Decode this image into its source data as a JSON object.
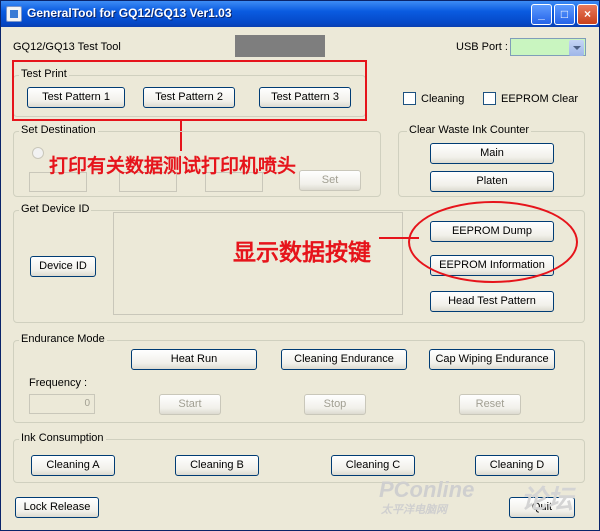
{
  "window": {
    "title": "GeneralTool for GQ12/GQ13 Ver1.03",
    "minimize": "_",
    "maximize": "□",
    "close": "×"
  },
  "header": {
    "tool_label": "GQ12/GQ13 Test Tool",
    "usb_label": "USB Port :",
    "usb_value": ""
  },
  "test_print": {
    "label": "Test Print",
    "buttons": [
      "Test Pattern 1",
      "Test Pattern 2",
      "Test Pattern 3"
    ]
  },
  "options": {
    "cleaning": "Cleaning",
    "eeprom_clear": "EEPROM Clear"
  },
  "set_destination": {
    "label": "Set Destination",
    "set_button": "Set"
  },
  "waste_ink": {
    "label": "Clear Waste Ink Counter",
    "main": "Main",
    "platen": "Platen"
  },
  "device_id": {
    "label": "Get Device ID",
    "button": "Device ID",
    "eeprom_dump": "EEPROM Dump",
    "eeprom_info": "EEPROM Information",
    "head_test": "Head Test Pattern"
  },
  "endurance": {
    "label": "Endurance Mode",
    "heat_run": "Heat Run",
    "cleaning_endurance": "Cleaning Endurance",
    "cap_wiping": "Cap Wiping Endurance",
    "frequency_label": "Frequency :",
    "frequency_value": "0",
    "start": "Start",
    "stop": "Stop",
    "reset": "Reset"
  },
  "ink": {
    "label": "Ink Consumption",
    "buttons": [
      "Cleaning A",
      "Cleaning B",
      "Cleaning C",
      "Cleaning D"
    ]
  },
  "footer": {
    "lock_release": "Lock Release",
    "quit": "Quit"
  },
  "annotations": {
    "print_note": "打印有关数据测试打印机喷头",
    "data_note": "显示数据按键"
  },
  "watermark": {
    "brand": "PConline",
    "sub": "太平洋电脑网",
    "forum": "论坛"
  },
  "colors": {
    "annotation": "#e6141b",
    "titlebar": "#0548c7",
    "usb_field": "#c9f5c0"
  }
}
